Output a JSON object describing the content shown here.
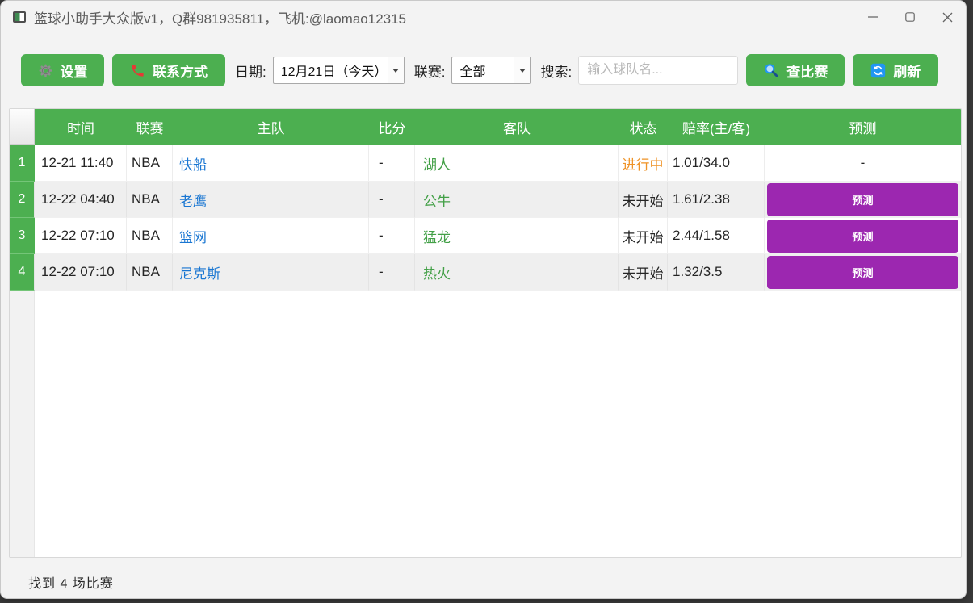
{
  "window": {
    "title": "篮球小助手大众版v1，Q群981935811，飞机:@laomao12315"
  },
  "toolbar": {
    "settings_label": "设置",
    "contact_label": "联系方式",
    "date_label": "日期:",
    "date_value": "12月21日（今天）",
    "league_label": "联赛:",
    "league_value": "全部",
    "search_label": "搜索:",
    "search_placeholder": "输入球队名...",
    "find_label": "查比赛",
    "refresh_label": "刷新"
  },
  "table": {
    "headers": [
      "时间",
      "联赛",
      "主队",
      "比分",
      "客队",
      "状态",
      "赔率(主/客)",
      "预测"
    ],
    "rows": [
      {
        "num": "1",
        "time": "12-21 11:40",
        "league": "NBA",
        "home": "快船",
        "score": "-",
        "away": "湖人",
        "status": "进行中",
        "status_type": "live",
        "odds": "1.01/34.0",
        "prediction": "-",
        "has_button": false
      },
      {
        "num": "2",
        "time": "12-22 04:40",
        "league": "NBA",
        "home": "老鹰",
        "score": "-",
        "away": "公牛",
        "status": "未开始",
        "status_type": "upcoming",
        "odds": "1.61/2.38",
        "prediction": "预测",
        "has_button": true
      },
      {
        "num": "3",
        "time": "12-22 07:10",
        "league": "NBA",
        "home": "篮网",
        "score": "-",
        "away": "猛龙",
        "status": "未开始",
        "status_type": "upcoming",
        "odds": "2.44/1.58",
        "prediction": "预测",
        "has_button": true
      },
      {
        "num": "4",
        "time": "12-22 07:10",
        "league": "NBA",
        "home": "尼克斯",
        "score": "-",
        "away": "热火",
        "status": "未开始",
        "status_type": "upcoming",
        "odds": "1.32/3.5",
        "prediction": "预测",
        "has_button": true
      }
    ]
  },
  "status_bar": {
    "text": "找到 4 场比赛"
  },
  "colors": {
    "accent_green": "#4caf50",
    "purple": "#9c27b0",
    "home_team_blue": "#1976d2",
    "away_team_green": "#43a047",
    "live_orange": "#ef9327",
    "icon_blue": "#2196f3",
    "phone_red": "#e53935"
  }
}
